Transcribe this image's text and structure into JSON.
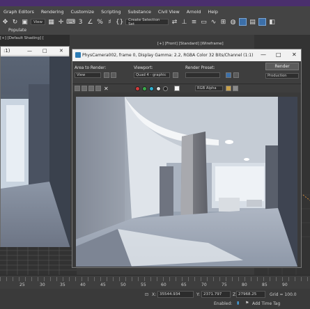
{
  "menu": [
    "Graph Editors",
    "Rendering",
    "Customize",
    "Scripting",
    "Substance",
    "Civil View",
    "Arnold",
    "Help"
  ],
  "toolbar": {
    "view_dropdown": "View",
    "selection_set": "Create Selection Set",
    "populate_label": "Populate"
  },
  "left_viewport": {
    "label": "[+] [Default Shading] ["
  },
  "viewport_header": "[+] [Front] [Standard] [Wireframe]",
  "render_window": {
    "title": "PhysCamera002, frame 0, Display Gamma: 2.2, RGBA Color 32 Bits/Channel (1:1)",
    "area_label": "Area to Render:",
    "area_value": "View",
    "viewport_label": "Viewport:",
    "viewport_value": "Quad 4 - graphic",
    "preset_label": "Render Preset:",
    "preset_value": "",
    "render_button": "Render",
    "production_value": "Production",
    "channel_value": "RGB Alpha"
  },
  "timeline": {
    "ticks": [
      "25",
      "30",
      "35",
      "40",
      "45",
      "50",
      "55",
      "60",
      "65",
      "70",
      "75",
      "80",
      "85",
      "90"
    ]
  },
  "status": {
    "x_label": "X:",
    "x_value": "35544.934",
    "y_label": "Y:",
    "y_value": "2371.797",
    "z_label": "Z:",
    "z_value": "27968.25",
    "grid": "Grid = 100.0",
    "enabled": "Enabled:",
    "add_time_tag": "Add Time Tag"
  },
  "colors": {
    "title_strip": "#4a2f6d",
    "dot_red": "#d23a3a",
    "dot_green": "#3aa84a",
    "dot_cyan": "#2fb0d0"
  }
}
